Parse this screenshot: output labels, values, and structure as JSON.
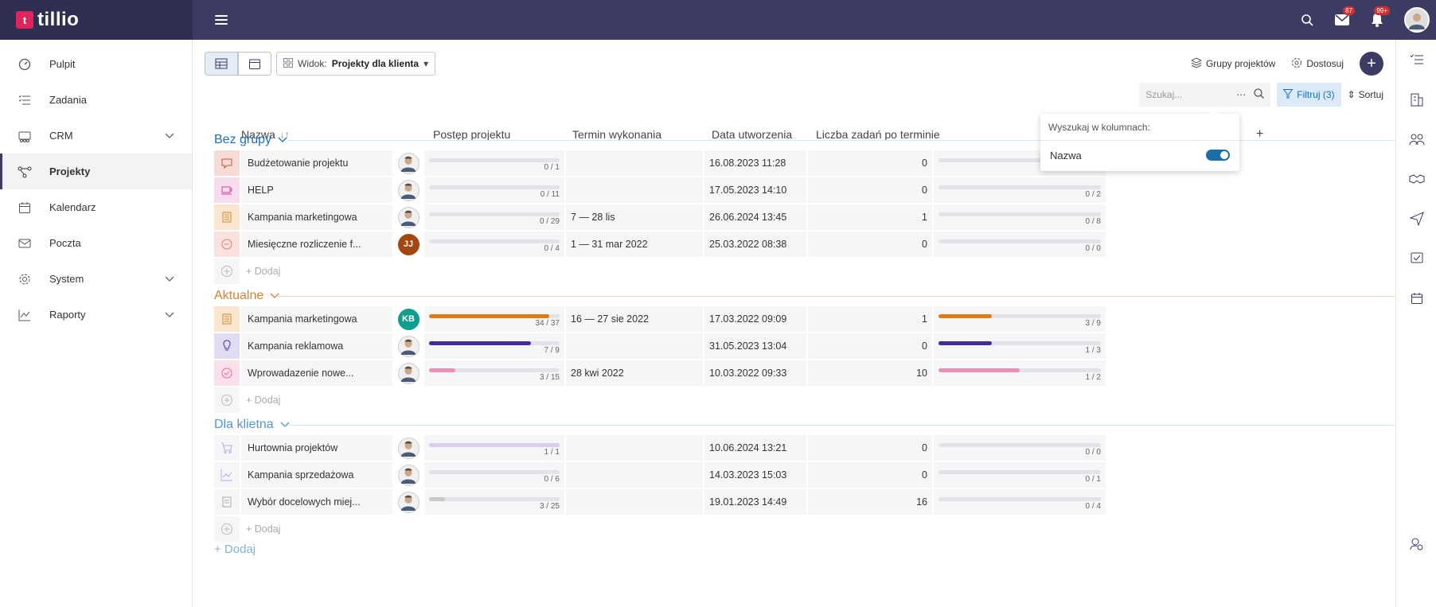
{
  "app": {
    "logo_text": "tillio",
    "logo_glyph": "t"
  },
  "topbar": {
    "mail_badge": "87",
    "bell_badge": "99+"
  },
  "sidebar": {
    "items": [
      {
        "label": "Pulpit",
        "icon": "dashboard-icon"
      },
      {
        "label": "Zadania",
        "icon": "tasks-icon"
      },
      {
        "label": "CRM",
        "icon": "crm-icon"
      },
      {
        "label": "Projekty",
        "icon": "projects-icon"
      },
      {
        "label": "Kalendarz",
        "icon": "calendar-icon"
      },
      {
        "label": "Poczta",
        "icon": "mail-icon"
      },
      {
        "label": "System",
        "icon": "gear-icon"
      },
      {
        "label": "Raporty",
        "icon": "chart-icon"
      }
    ]
  },
  "toolbar": {
    "view_prefix": "Widok:",
    "view_value": "Projekty dla klienta"
  },
  "actions": {
    "groups": "Grupy projektów",
    "customize": "Dostosuj"
  },
  "search": {
    "placeholder": "Szukaj...",
    "filter_label": "Filtruj (3)",
    "sort_label": "Sortuj"
  },
  "popup": {
    "title": "Wyszukaj w kolumnach:",
    "option": "Nazwa"
  },
  "columns": {
    "name": "Nazwa",
    "progress": "Postęp projektu",
    "deadline": "Termin wykonania",
    "created": "Data utworzenia",
    "overdue": "Liczba zadań po terminie"
  },
  "add_label": "+ Dodaj",
  "add_group_label": "+ Dodaj",
  "groups": [
    {
      "name": "Bez grupy",
      "color": "#1a6fc2",
      "line": "#d5e6f3",
      "rows": [
        {
          "name": "Budżetowanie projektu",
          "icon": "comment-icon",
          "icon_color": "#c0553c",
          "icon_bg": "#f7dcd5",
          "avatar": "photo",
          "prog_label": "0 / 1",
          "prog": 0,
          "prog_color": "#e2e3e6",
          "deadline": "",
          "created": "16.08.2023 11:28",
          "overdue": "0",
          "tasks_label": "0 / 0",
          "tasks": 0,
          "tasks_color": "#e2e3e6"
        },
        {
          "name": "HELP",
          "icon": "cup-icon",
          "icon_color": "#c9469b",
          "icon_bg": "#f6dcef",
          "avatar": "photo",
          "prog_label": "0 / 11",
          "prog": 0,
          "prog_color": "#e2e3e6",
          "deadline": "",
          "created": "17.05.2023 14:10",
          "overdue": "0",
          "tasks_label": "0 / 2",
          "tasks": 0,
          "tasks_color": "#e2e3e6"
        },
        {
          "name": "Kampania marketingowa",
          "icon": "book-icon",
          "icon_color": "#d9822b",
          "icon_bg": "#fbe6cf",
          "avatar": "photo",
          "prog_label": "0 / 29",
          "prog": 0,
          "prog_color": "#e2e3e6",
          "deadline": "7 — 28 lis",
          "created": "26.06.2024 13:45",
          "overdue": "1",
          "tasks_label": "0 / 8",
          "tasks": 0,
          "tasks_color": "#e2e3e6"
        },
        {
          "name": "Miesięczne rozliczenie f...",
          "icon": "minus-circle-icon",
          "icon_color": "#e07a6c",
          "icon_bg": "#fbe2de",
          "avatar": "JJ",
          "avatar_bg": "#a4460f",
          "prog_label": "0 / 4",
          "prog": 0,
          "prog_color": "#e2e3e6",
          "deadline": "1 — 31 mar 2022",
          "created": "25.03.2022 08:38",
          "overdue": "0",
          "tasks_label": "0 / 0",
          "tasks": 0,
          "tasks_color": "#e2e3e6"
        }
      ]
    },
    {
      "name": "Aktualne",
      "color": "#d9822b",
      "line": "#f1dcc2",
      "rows": [
        {
          "name": "Kampania marketingowa",
          "icon": "book-icon",
          "icon_color": "#d9822b",
          "icon_bg": "#fbe6cf",
          "avatar": "KB",
          "avatar_bg": "#0f9d8f",
          "prog_label": "34 / 37",
          "prog": 0.92,
          "prog_color": "#e07b12",
          "deadline": "16 — 27 sie 2022",
          "created": "17.03.2022 09:09",
          "overdue": "1",
          "tasks_label": "3 / 9",
          "tasks": 0.33,
          "tasks_color": "#e07b12"
        },
        {
          "name": "Kampania reklamowa",
          "icon": "bulb-icon",
          "icon_color": "#4b32a0",
          "icon_bg": "#e1dbf3",
          "avatar": "photo",
          "prog_label": "7 / 9",
          "prog": 0.78,
          "prog_color": "#46289a",
          "deadline": "",
          "created": "31.05.2023 13:04",
          "overdue": "0",
          "tasks_label": "1 / 3",
          "tasks": 0.33,
          "tasks_color": "#46289a"
        },
        {
          "name": "Wprowadazenie nowe...",
          "icon": "check-circle-icon",
          "icon_color": "#e06aa0",
          "icon_bg": "#fbe0ec",
          "avatar": "photo",
          "prog_label": "3 / 15",
          "prog": 0.2,
          "prog_color": "#ec8fb7",
          "deadline": "28 kwi 2022",
          "created": "10.03.2022 09:33",
          "overdue": "10",
          "tasks_label": "1 / 2",
          "tasks": 0.5,
          "tasks_color": "#ec8fb7"
        }
      ]
    },
    {
      "name": "Dla klietna",
      "color": "#4f95d8",
      "line": "#d5e6f3",
      "rows": [
        {
          "name": "Hurtownia projektów",
          "icon": "cart-icon",
          "icon_color": "#b6a8e2",
          "icon_bg": "#f4f6f8",
          "avatar": "photo",
          "prog_label": "1 / 1",
          "prog": 1,
          "prog_color": "#d8cdf0",
          "deadline": "",
          "created": "10.06.2024 13:21",
          "overdue": "0",
          "tasks_label": "0 / 0",
          "tasks": 0,
          "tasks_color": "#e2e3e6"
        },
        {
          "name": "Kampania sprzedażowa",
          "icon": "chart-icon",
          "icon_color": "#b6a8e2",
          "icon_bg": "#f4f6f8",
          "avatar": "photo",
          "prog_label": "0 / 6",
          "prog": 0,
          "prog_color": "#e2e3e6",
          "deadline": "",
          "created": "14.03.2023 15:03",
          "overdue": "0",
          "tasks_label": "0 / 1",
          "tasks": 0,
          "tasks_color": "#e2e3e6"
        },
        {
          "name": "Wybór docelowych miej...",
          "icon": "doc-icon",
          "icon_color": "#aaa",
          "icon_bg": "#f4f6f8",
          "avatar": "photo",
          "prog_label": "3 / 25",
          "prog": 0.12,
          "prog_color": "#c8c8c8",
          "deadline": "",
          "created": "19.01.2023 14:49",
          "overdue": "16",
          "tasks_label": "0 / 4",
          "tasks": 0,
          "tasks_color": "#e2e3e6"
        }
      ]
    }
  ]
}
